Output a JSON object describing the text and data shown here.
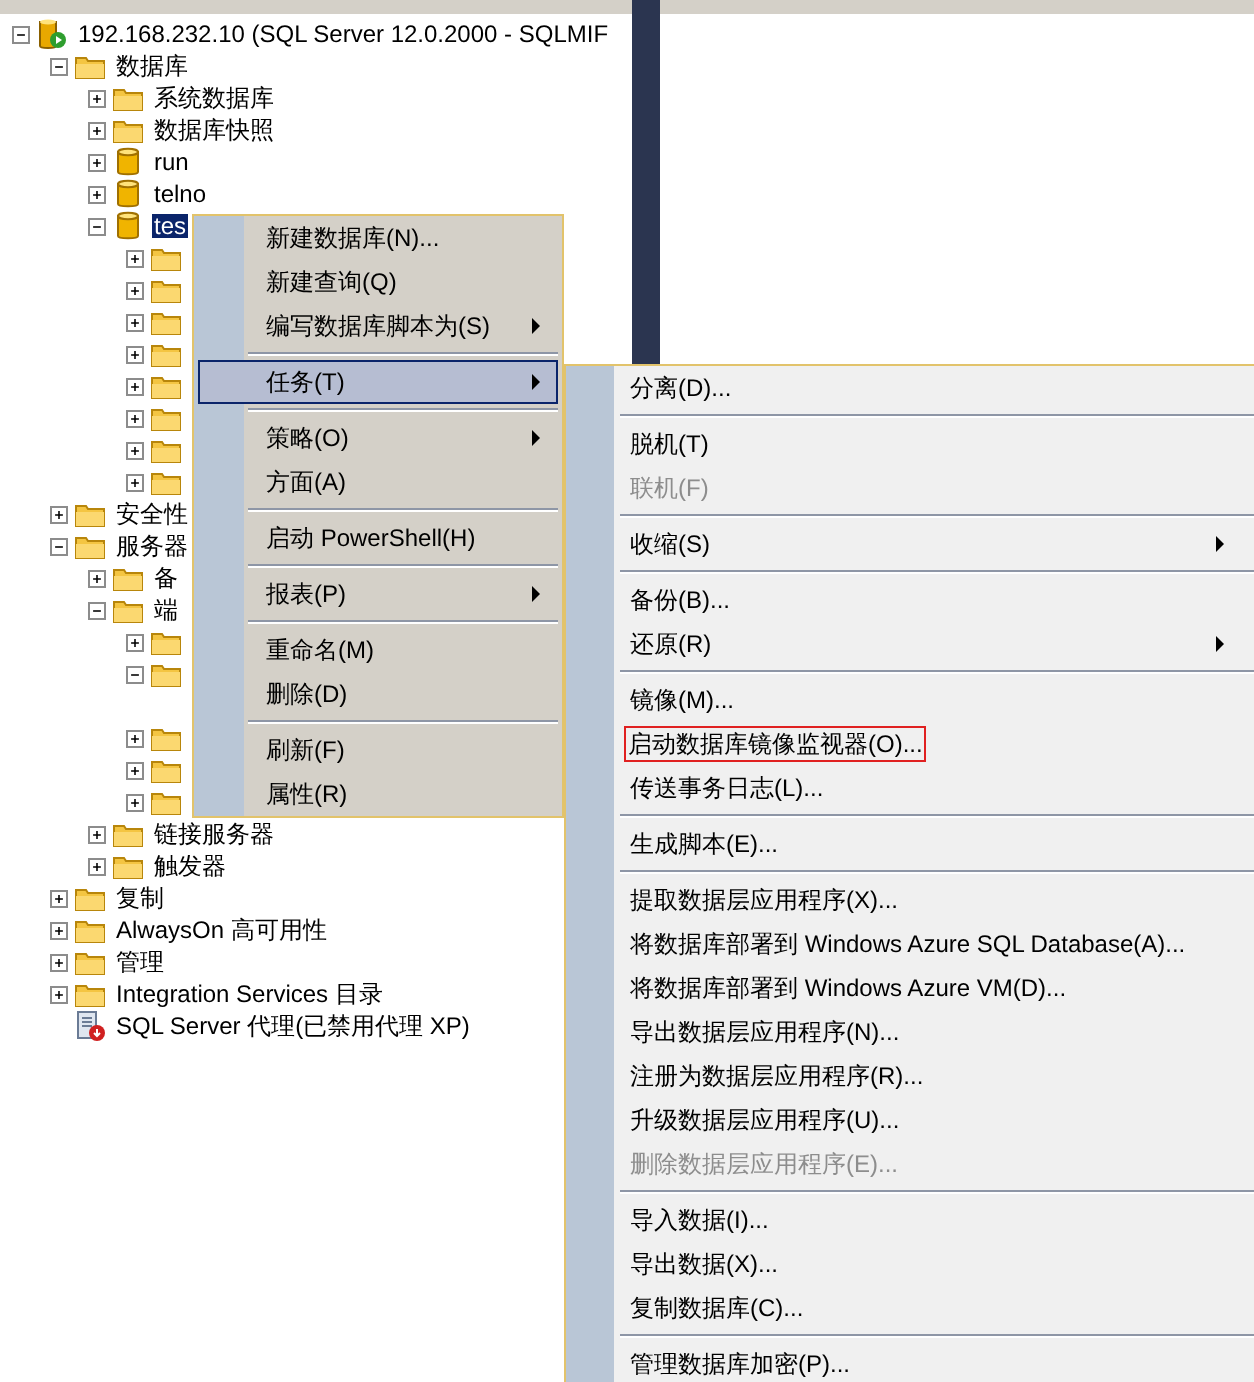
{
  "tree": [
    {
      "label": "192.168.232.10 (SQL Server 12.0.2000 - SQLMIF",
      "kind": "server",
      "expanded": true,
      "selected": false,
      "children": [
        {
          "label": "数据库",
          "kind": "folder",
          "expanded": true,
          "selected": false,
          "children": [
            {
              "label": "系统数据库",
              "kind": "folder",
              "expanded": false,
              "selected": false
            },
            {
              "label": "数据库快照",
              "kind": "folder",
              "expanded": false,
              "selected": false
            },
            {
              "label": "run",
              "kind": "database",
              "expanded": false,
              "selected": false
            },
            {
              "label": "telno",
              "kind": "database",
              "expanded": false,
              "selected": false
            },
            {
              "label": "tes",
              "kind": "database",
              "expanded": true,
              "selected": true,
              "children": [
                {
                  "kind": "folder",
                  "expanded": false
                },
                {
                  "kind": "folder",
                  "expanded": false
                },
                {
                  "kind": "folder",
                  "expanded": false
                },
                {
                  "kind": "folder",
                  "expanded": false
                },
                {
                  "kind": "folder",
                  "expanded": false
                },
                {
                  "kind": "folder",
                  "expanded": false
                },
                {
                  "kind": "folder",
                  "expanded": false
                },
                {
                  "kind": "folder",
                  "expanded": false
                }
              ]
            }
          ]
        },
        {
          "label": "安全性",
          "kind": "folder",
          "expanded": false,
          "selected": false
        },
        {
          "label": "服务器",
          "kind": "folder",
          "expanded": true,
          "selected": false,
          "children": [
            {
              "label": "备",
              "kind": "folder",
              "expanded": false,
              "selected": false
            },
            {
              "label": "端",
              "kind": "folder",
              "expanded": true,
              "selected": false,
              "children": [
                {
                  "kind": "folder",
                  "expanded": false
                },
                {
                  "kind": "folder",
                  "expanded": true
                },
                {
                  "kind": "folder",
                  "expanded": false
                },
                {
                  "kind": "folder",
                  "expanded": false
                },
                {
                  "kind": "folder",
                  "expanded": false
                }
              ]
            },
            {
              "label": "链接服务器",
              "kind": "folder",
              "expanded": false,
              "selected": false
            },
            {
              "label": "触发器",
              "kind": "folder",
              "expanded": false,
              "selected": false
            }
          ]
        },
        {
          "label": "复制",
          "kind": "folder",
          "expanded": false,
          "selected": false
        },
        {
          "label": "AlwaysOn 高可用性",
          "kind": "folder",
          "expanded": false,
          "selected": false
        },
        {
          "label": "管理",
          "kind": "folder",
          "expanded": false,
          "selected": false
        },
        {
          "label": "Integration Services 目录",
          "kind": "folder",
          "expanded": false,
          "selected": false
        },
        {
          "label": "SQL Server 代理(已禁用代理 XP)",
          "kind": "agent",
          "selected": false
        }
      ]
    }
  ],
  "context_menu": [
    {
      "kind": "item",
      "label": "新建数据库(N)...",
      "submenu": false,
      "selected": false
    },
    {
      "kind": "item",
      "label": "新建查询(Q)",
      "submenu": false,
      "selected": false
    },
    {
      "kind": "item",
      "label": "编写数据库脚本为(S)",
      "submenu": true,
      "selected": false
    },
    {
      "kind": "separator"
    },
    {
      "kind": "item",
      "label": "任务(T)",
      "submenu": true,
      "selected": true
    },
    {
      "kind": "separator"
    },
    {
      "kind": "item",
      "label": "策略(O)",
      "submenu": true,
      "selected": false
    },
    {
      "kind": "item",
      "label": "方面(A)",
      "submenu": false,
      "selected": false
    },
    {
      "kind": "separator"
    },
    {
      "kind": "item",
      "label": "启动 PowerShell(H)",
      "submenu": false,
      "selected": false
    },
    {
      "kind": "separator"
    },
    {
      "kind": "item",
      "label": "报表(P)",
      "submenu": true,
      "selected": false
    },
    {
      "kind": "separator"
    },
    {
      "kind": "item",
      "label": "重命名(M)",
      "submenu": false,
      "selected": false
    },
    {
      "kind": "item",
      "label": "删除(D)",
      "submenu": false,
      "selected": false
    },
    {
      "kind": "separator"
    },
    {
      "kind": "item",
      "label": "刷新(F)",
      "submenu": false,
      "selected": false
    },
    {
      "kind": "item",
      "label": "属性(R)",
      "submenu": false,
      "selected": false
    }
  ],
  "tasks_submenu": [
    {
      "kind": "item",
      "label": "分离(D)...",
      "submenu": false,
      "disabled": false,
      "outlined": false
    },
    {
      "kind": "separator"
    },
    {
      "kind": "item",
      "label": "脱机(T)",
      "submenu": false,
      "disabled": false,
      "outlined": false
    },
    {
      "kind": "item",
      "label": "联机(F)",
      "submenu": false,
      "disabled": true,
      "outlined": false
    },
    {
      "kind": "separator"
    },
    {
      "kind": "item",
      "label": "收缩(S)",
      "submenu": true,
      "disabled": false,
      "outlined": false
    },
    {
      "kind": "separator"
    },
    {
      "kind": "item",
      "label": "备份(B)...",
      "submenu": false,
      "disabled": false,
      "outlined": false
    },
    {
      "kind": "item",
      "label": "还原(R)",
      "submenu": true,
      "disabled": false,
      "outlined": false
    },
    {
      "kind": "separator"
    },
    {
      "kind": "item",
      "label": "镜像(M)...",
      "submenu": false,
      "disabled": false,
      "outlined": false
    },
    {
      "kind": "item",
      "label": "启动数据库镜像监视器(O)...",
      "submenu": false,
      "disabled": false,
      "outlined": true
    },
    {
      "kind": "item",
      "label": "传送事务日志(L)...",
      "submenu": false,
      "disabled": false,
      "outlined": false
    },
    {
      "kind": "separator"
    },
    {
      "kind": "item",
      "label": "生成脚本(E)...",
      "submenu": false,
      "disabled": false,
      "outlined": false
    },
    {
      "kind": "separator"
    },
    {
      "kind": "item",
      "label": "提取数据层应用程序(X)...",
      "submenu": false,
      "disabled": false,
      "outlined": false
    },
    {
      "kind": "item",
      "label": "将数据库部署到 Windows Azure SQL Database(A)...",
      "submenu": false,
      "disabled": false,
      "outlined": false
    },
    {
      "kind": "item",
      "label": "将数据库部署到 Windows Azure VM(D)...",
      "submenu": false,
      "disabled": false,
      "outlined": false
    },
    {
      "kind": "item",
      "label": "导出数据层应用程序(N)...",
      "submenu": false,
      "disabled": false,
      "outlined": false
    },
    {
      "kind": "item",
      "label": "注册为数据层应用程序(R)...",
      "submenu": false,
      "disabled": false,
      "outlined": false
    },
    {
      "kind": "item",
      "label": "升级数据层应用程序(U)...",
      "submenu": false,
      "disabled": false,
      "outlined": false
    },
    {
      "kind": "item",
      "label": "删除数据层应用程序(E)...",
      "submenu": false,
      "disabled": true,
      "outlined": false
    },
    {
      "kind": "separator"
    },
    {
      "kind": "item",
      "label": "导入数据(I)...",
      "submenu": false,
      "disabled": false,
      "outlined": false
    },
    {
      "kind": "item",
      "label": "导出数据(X)...",
      "submenu": false,
      "disabled": false,
      "outlined": false
    },
    {
      "kind": "item",
      "label": "复制数据库(C)...",
      "submenu": false,
      "disabled": false,
      "outlined": false
    },
    {
      "kind": "separator"
    },
    {
      "kind": "item",
      "label": "管理数据库加密(P)...",
      "submenu": false,
      "disabled": false,
      "outlined": false
    }
  ]
}
